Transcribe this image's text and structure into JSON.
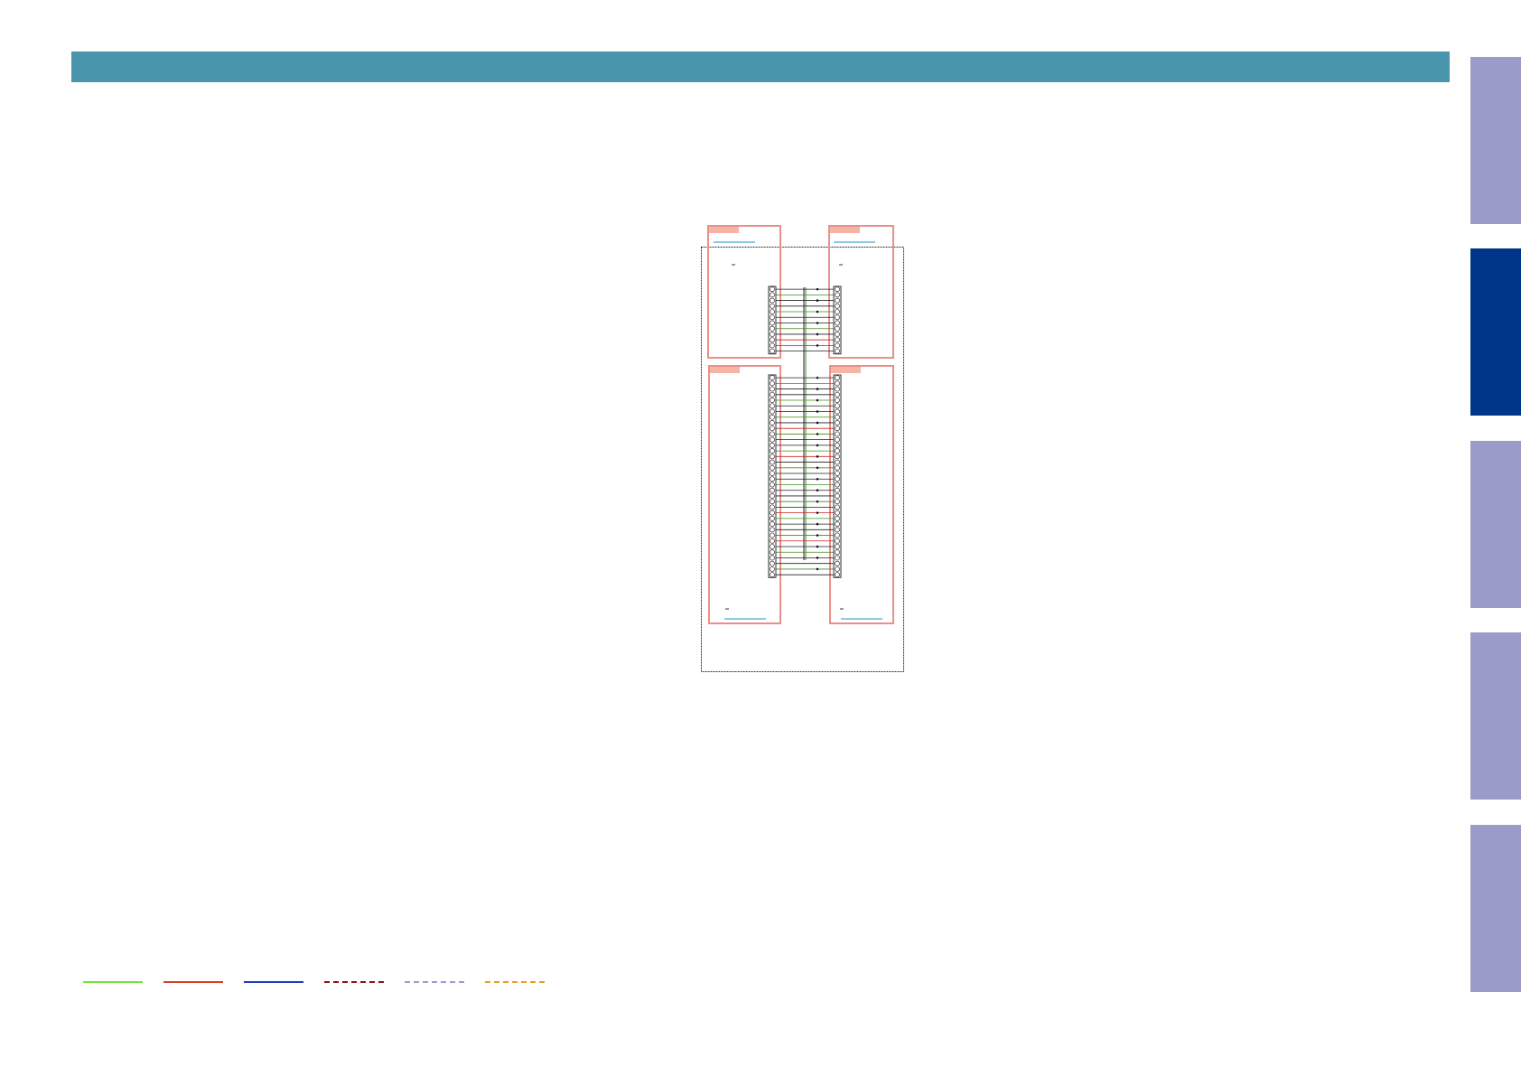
{
  "colors": {
    "header": "#4a97ad",
    "tab_inactive": "#9b9bc8",
    "tab_active": "#00368a",
    "pcb_outline": "#e8908a",
    "pcb_label_fill": "#f5b4a4",
    "ref_underline": "#69b7d8",
    "connector": "#333333",
    "wire": "#222222",
    "signal_green": "#3f8f1f",
    "signal_red": "#c8261c"
  },
  "header": {
    "title": ""
  },
  "tabs": [
    {
      "label": "",
      "state": "inactive"
    },
    {
      "label": "",
      "state": "active"
    },
    {
      "label": "",
      "state": "inactive"
    },
    {
      "label": "",
      "state": "inactive"
    },
    {
      "label": "",
      "state": "inactive"
    }
  ],
  "diagram": {
    "upper_connector_pins": 12,
    "lower_connector_pins": 36
  },
  "legend": [
    {
      "name": "green-solid",
      "color": "#74e33b",
      "style": "solid"
    },
    {
      "name": "red-solid",
      "color": "#d9402c",
      "style": "solid"
    },
    {
      "name": "blue-solid",
      "color": "#1e3cc4",
      "style": "solid"
    },
    {
      "name": "darkred-dashed",
      "color": "#8a1313",
      "style": "dashed"
    },
    {
      "name": "lavender-dashed",
      "color": "#9b9bdc",
      "style": "dashed"
    },
    {
      "name": "orange-dashed",
      "color": "#e5a02a",
      "style": "dashed"
    }
  ]
}
